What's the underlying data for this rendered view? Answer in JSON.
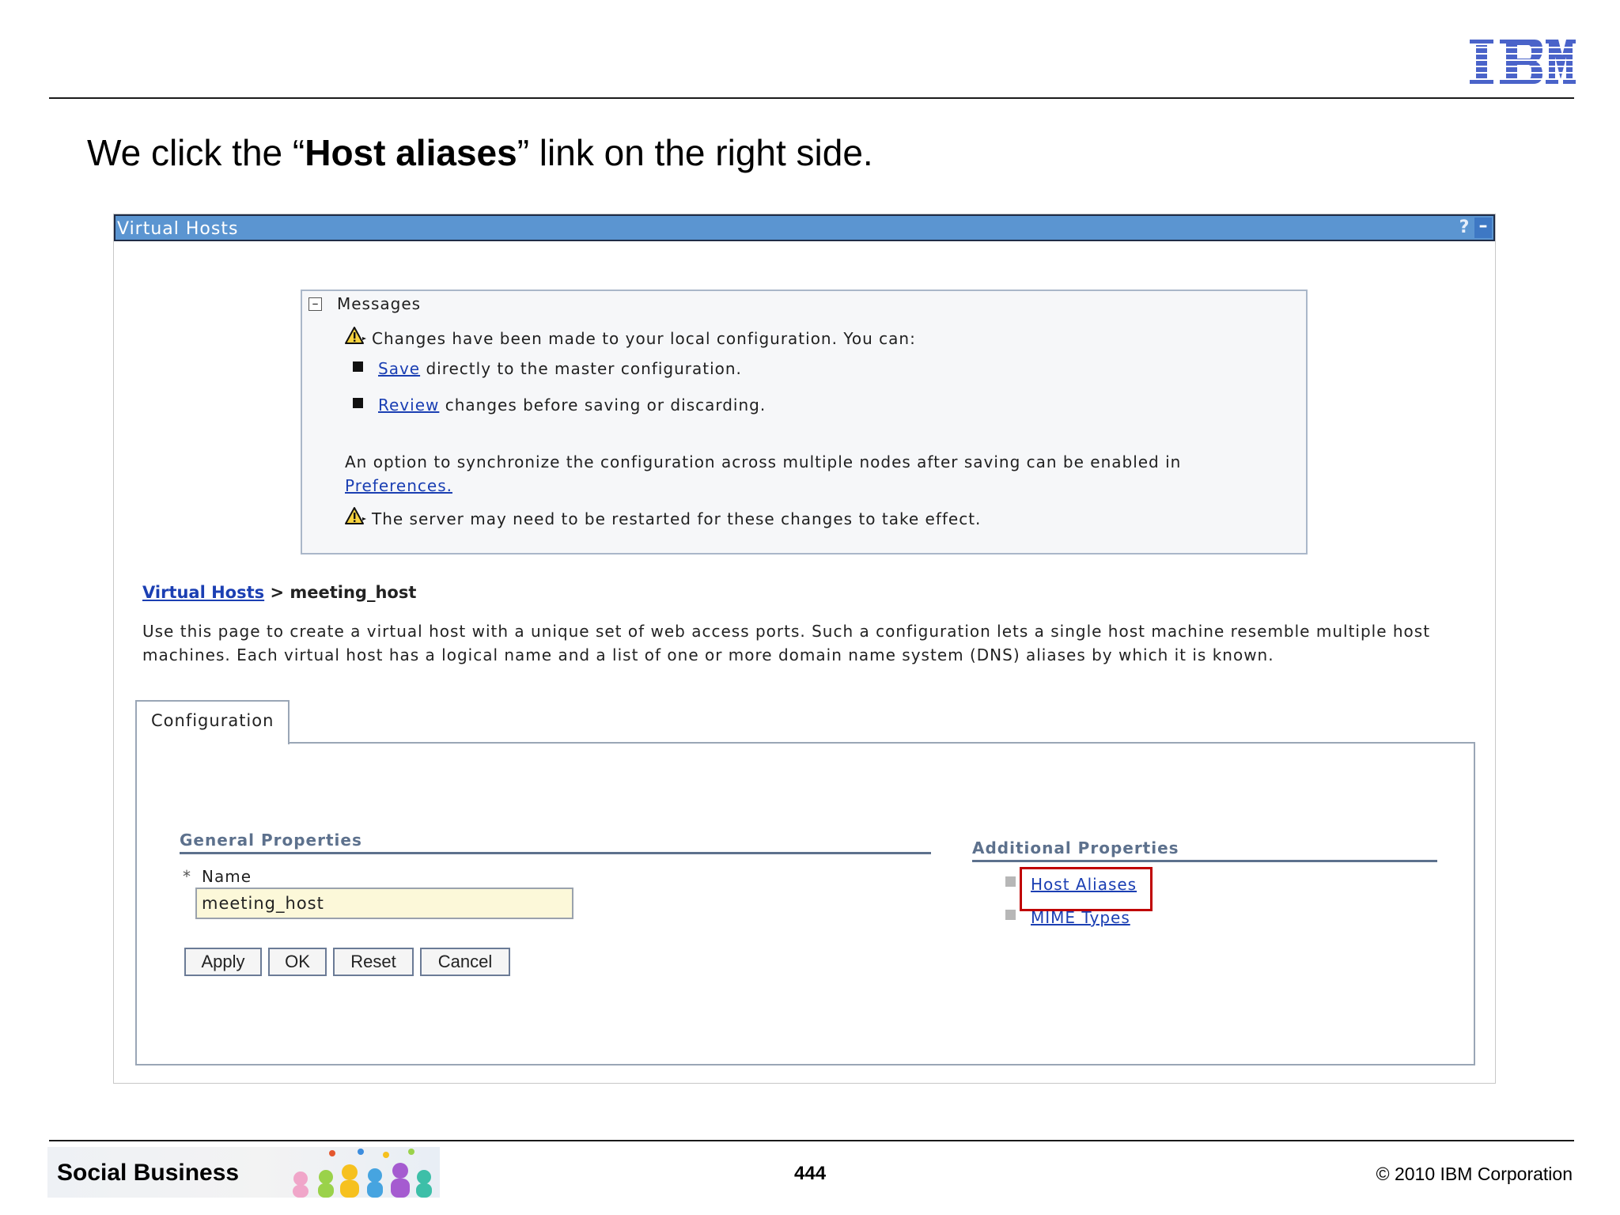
{
  "slide": {
    "title_prefix": "We click the “",
    "title_bold": "Host aliases",
    "title_suffix": "” link on the right side.",
    "logo_text": "IBM"
  },
  "panel": {
    "title": "Virtual Hosts",
    "help_label": "?",
    "minimize_label": "–"
  },
  "messages": {
    "heading": "Messages",
    "collapse_label": "–",
    "warning_1": "Changes have been made to your local configuration. You can:",
    "save_link": "Save",
    "save_text": "directly to the master configuration.",
    "review_link": "Review",
    "review_text": "changes before saving or discarding.",
    "sync_text": "An option to synchronize the configuration across multiple nodes after saving can be enabled in",
    "preferences_link": "Preferences.",
    "warning_2": "The server may need to be restarted for these changes to take effect."
  },
  "breadcrumb": {
    "parent": "Virtual Hosts",
    "separator": " > ",
    "current": "meeting_host"
  },
  "description": "Use this page to create a virtual host with a unique set of web access ports. Such a configuration lets a single host machine resemble multiple host machines. Each virtual host has a logical name and a list of one or more domain name system (DNS) aliases by which it is known.",
  "tabs": [
    {
      "label": "Configuration"
    }
  ],
  "general_properties": {
    "heading": "General Properties",
    "required_marker": "*",
    "name_label": "Name",
    "name_value": "meeting_host"
  },
  "buttons": {
    "apply": "Apply",
    "ok": "OK",
    "reset": "Reset",
    "cancel": "Cancel"
  },
  "additional_properties": {
    "heading": "Additional Properties",
    "links": [
      "Host Aliases",
      "MIME Types"
    ],
    "highlight_color": "#c00000"
  },
  "footer": {
    "brand": "Social Business",
    "page_number": "444",
    "copyright": "© 2010 IBM Corporation"
  },
  "colors": {
    "titlebar": "#5b95d1",
    "link": "#1b3fb3",
    "section_heading": "#5d718d",
    "input_bg": "#fcf8d9"
  }
}
